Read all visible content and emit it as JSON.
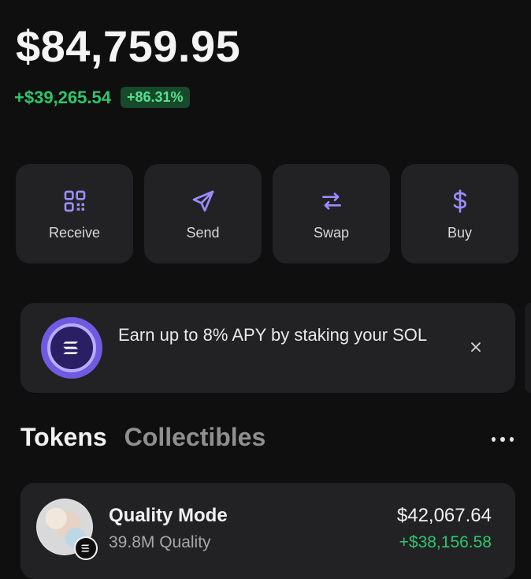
{
  "portfolio": {
    "balance": "$84,759.95",
    "change_amount": "+$39,265.54",
    "change_percent": "+86.31%"
  },
  "actions": [
    {
      "label": "Receive",
      "icon": "qr-code-icon"
    },
    {
      "label": "Send",
      "icon": "send-icon"
    },
    {
      "label": "Swap",
      "icon": "swap-icon"
    },
    {
      "label": "Buy",
      "icon": "dollar-icon"
    }
  ],
  "banner": {
    "text": "Earn up to 8% APY by staking your SOL",
    "icon": "solana-icon",
    "close_icon": "close-icon"
  },
  "tabs": {
    "active": "Tokens",
    "inactive": "Collectibles",
    "more_icon": "more-icon"
  },
  "tokens": [
    {
      "name": "Quality Mode",
      "quantity": "39.8M Quality",
      "value": "$42,067.64",
      "change": "+$38,156.58",
      "avatar_icon": "token-avatar-icon",
      "chain_icon": "solana-chain-icon"
    }
  ],
  "colors": {
    "background": "#0f0f10",
    "card": "#222225",
    "positive": "#2bc86a",
    "accent_purple": "#8f7cff"
  }
}
